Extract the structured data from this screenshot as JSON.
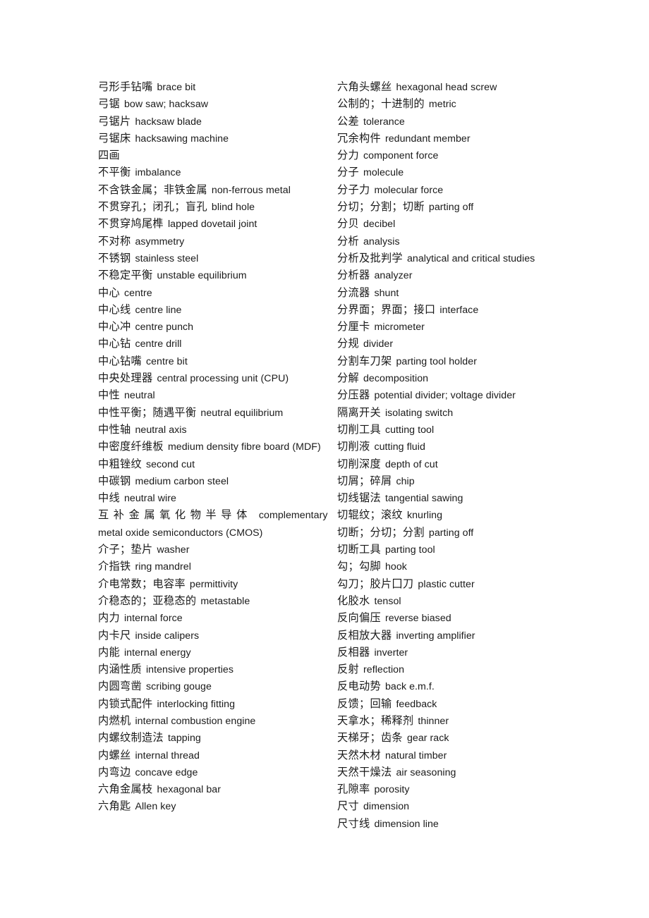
{
  "document": {
    "type": "bilingual-glossary-page",
    "background_color": "#ffffff",
    "text_color": "#1a1a1a",
    "columns": 2
  },
  "left_column": [
    {
      "zh": "弓形手钻嘴",
      "en": "brace bit"
    },
    {
      "zh": "弓锯",
      "en": "bow saw; hacksaw"
    },
    {
      "zh": "弓锯片",
      "en": "hacksaw blade"
    },
    {
      "zh": "弓锯床",
      "en": "hacksawing machine"
    },
    {
      "zh": "四画",
      "en": ""
    },
    {
      "zh": "不平衡",
      "en": "imbalance"
    },
    {
      "zh": "不含铁金属；非铁金属",
      "en": "non-ferrous metal"
    },
    {
      "zh": "不贯穿孔；闭孔；盲孔",
      "en": "blind hole"
    },
    {
      "zh": "不贯穿鸠尾榫",
      "en": "lapped dovetail joint"
    },
    {
      "zh": "不对称",
      "en": "asymmetry"
    },
    {
      "zh": "不锈钢",
      "en": "stainless steel"
    },
    {
      "zh": "不稳定平衡",
      "en": "unstable equilibrium"
    },
    {
      "zh": "中心",
      "en": "centre"
    },
    {
      "zh": "中心线",
      "en": "centre line"
    },
    {
      "zh": "中心冲",
      "en": "centre punch"
    },
    {
      "zh": "中心钻",
      "en": "centre drill"
    },
    {
      "zh": "中心钻嘴",
      "en": "centre bit"
    },
    {
      "zh": "中央处理器",
      "en": "central processing unit (CPU)"
    },
    {
      "zh": "中性",
      "en": "neutral"
    },
    {
      "zh": "中性平衡；随遇平衡",
      "en": "neutral equilibrium"
    },
    {
      "zh": "中性轴",
      "en": "neutral axis"
    },
    {
      "zh": "中密度纤维板",
      "en": "medium density fibre board (MDF)"
    },
    {
      "zh": "中粗锉纹",
      "en": "second cut"
    },
    {
      "zh": "中碳钢",
      "en": "medium carbon steel"
    },
    {
      "zh": "中线",
      "en": "neutral wire"
    },
    {
      "zh": "互补金属氧化物半导体",
      "en": "complementary metal oxide semiconductors (CMOS)",
      "tracked": true
    },
    {
      "zh": "介子；垫片",
      "en": "washer"
    },
    {
      "zh": "介指铁",
      "en": "ring mandrel"
    },
    {
      "zh": "介电常数；电容率",
      "en": "permittivity"
    },
    {
      "zh": "介稳态的；亚稳态的",
      "en": "metastable"
    },
    {
      "zh": "内力",
      "en": "internal force"
    },
    {
      "zh": "内卡尺",
      "en": "inside calipers"
    },
    {
      "zh": "内能",
      "en": "internal energy"
    },
    {
      "zh": "内涵性质",
      "en": "intensive properties"
    },
    {
      "zh": "内圆弯凿",
      "en": "scribing gouge"
    },
    {
      "zh": "内锁式配件",
      "en": "interlocking fitting"
    },
    {
      "zh": "内燃机",
      "en": "internal combustion engine"
    },
    {
      "zh": "内螺纹制造法",
      "en": "tapping"
    },
    {
      "zh": "内螺丝",
      "en": "internal thread"
    },
    {
      "zh": "内弯边",
      "en": "concave edge"
    },
    {
      "zh": "六角金属枝",
      "en": "hexagonal bar"
    },
    {
      "zh": "六角匙",
      "en": "Allen key"
    }
  ],
  "right_column": [
    {
      "zh": "六角头螺丝",
      "en": "hexagonal head screw"
    },
    {
      "zh": "公制的；十进制的",
      "en": "metric"
    },
    {
      "zh": "公差",
      "en": "tolerance"
    },
    {
      "zh": "冗余构件",
      "en": "redundant member"
    },
    {
      "zh": "分力",
      "en": "component force"
    },
    {
      "zh": "分子",
      "en": "molecule"
    },
    {
      "zh": "分子力",
      "en": "molecular force"
    },
    {
      "zh": "分切；分割；切断",
      "en": "parting off"
    },
    {
      "zh": "分贝",
      "en": "decibel"
    },
    {
      "zh": "分析",
      "en": "analysis"
    },
    {
      "zh": "分析及批判学",
      "en": "analytical and critical studies"
    },
    {
      "zh": "分析器",
      "en": "analyzer"
    },
    {
      "zh": "分流器",
      "en": "shunt"
    },
    {
      "zh": "分界面；界面；接口",
      "en": "interface"
    },
    {
      "zh": "分厘卡",
      "en": "micrometer"
    },
    {
      "zh": "分规",
      "en": "divider"
    },
    {
      "zh": "分割车刀架",
      "en": "parting tool holder"
    },
    {
      "zh": "分解",
      "en": "decomposition"
    },
    {
      "zh": "分压器",
      "en": "potential divider; voltage divider"
    },
    {
      "zh": "隔离开关",
      "en": "isolating switch"
    },
    {
      "zh": "切削工具",
      "en": "cutting tool"
    },
    {
      "zh": "切削液",
      "en": "cutting fluid"
    },
    {
      "zh": "切削深度",
      "en": "depth of cut"
    },
    {
      "zh": "切屑；碎屑",
      "en": "chip"
    },
    {
      "zh": "切线锯法",
      "en": "tangential sawing"
    },
    {
      "zh": "切辊纹；滚纹",
      "en": "knurling"
    },
    {
      "zh": "切断；分切；分割",
      "en": "parting off"
    },
    {
      "zh": "切断工具",
      "en": "parting tool"
    },
    {
      "zh": "勾；勾脚",
      "en": "hook"
    },
    {
      "zh": "勾刀；胶片囗刀",
      "en": "plastic cutter"
    },
    {
      "zh": "化胶水",
      "en": "tensol"
    },
    {
      "zh": "反向偏压",
      "en": "reverse biased"
    },
    {
      "zh": "反相放大器",
      "en": "inverting amplifier"
    },
    {
      "zh": "反相器",
      "en": "inverter"
    },
    {
      "zh": "反射",
      "en": "reflection"
    },
    {
      "zh": "反电动势",
      "en": "back e.m.f."
    },
    {
      "zh": "反馈；回输",
      "en": "feedback"
    },
    {
      "zh": "天拿水；稀释剂",
      "en": "thinner"
    },
    {
      "zh": "天梯牙；齿条",
      "en": "gear rack"
    },
    {
      "zh": "天然木材",
      "en": "natural timber"
    },
    {
      "zh": "天然干燥法",
      "en": "air seasoning"
    },
    {
      "zh": "孔隙率",
      "en": "porosity"
    },
    {
      "zh": "尺寸",
      "en": "dimension"
    },
    {
      "zh": "尺寸线",
      "en": "dimension line"
    }
  ]
}
